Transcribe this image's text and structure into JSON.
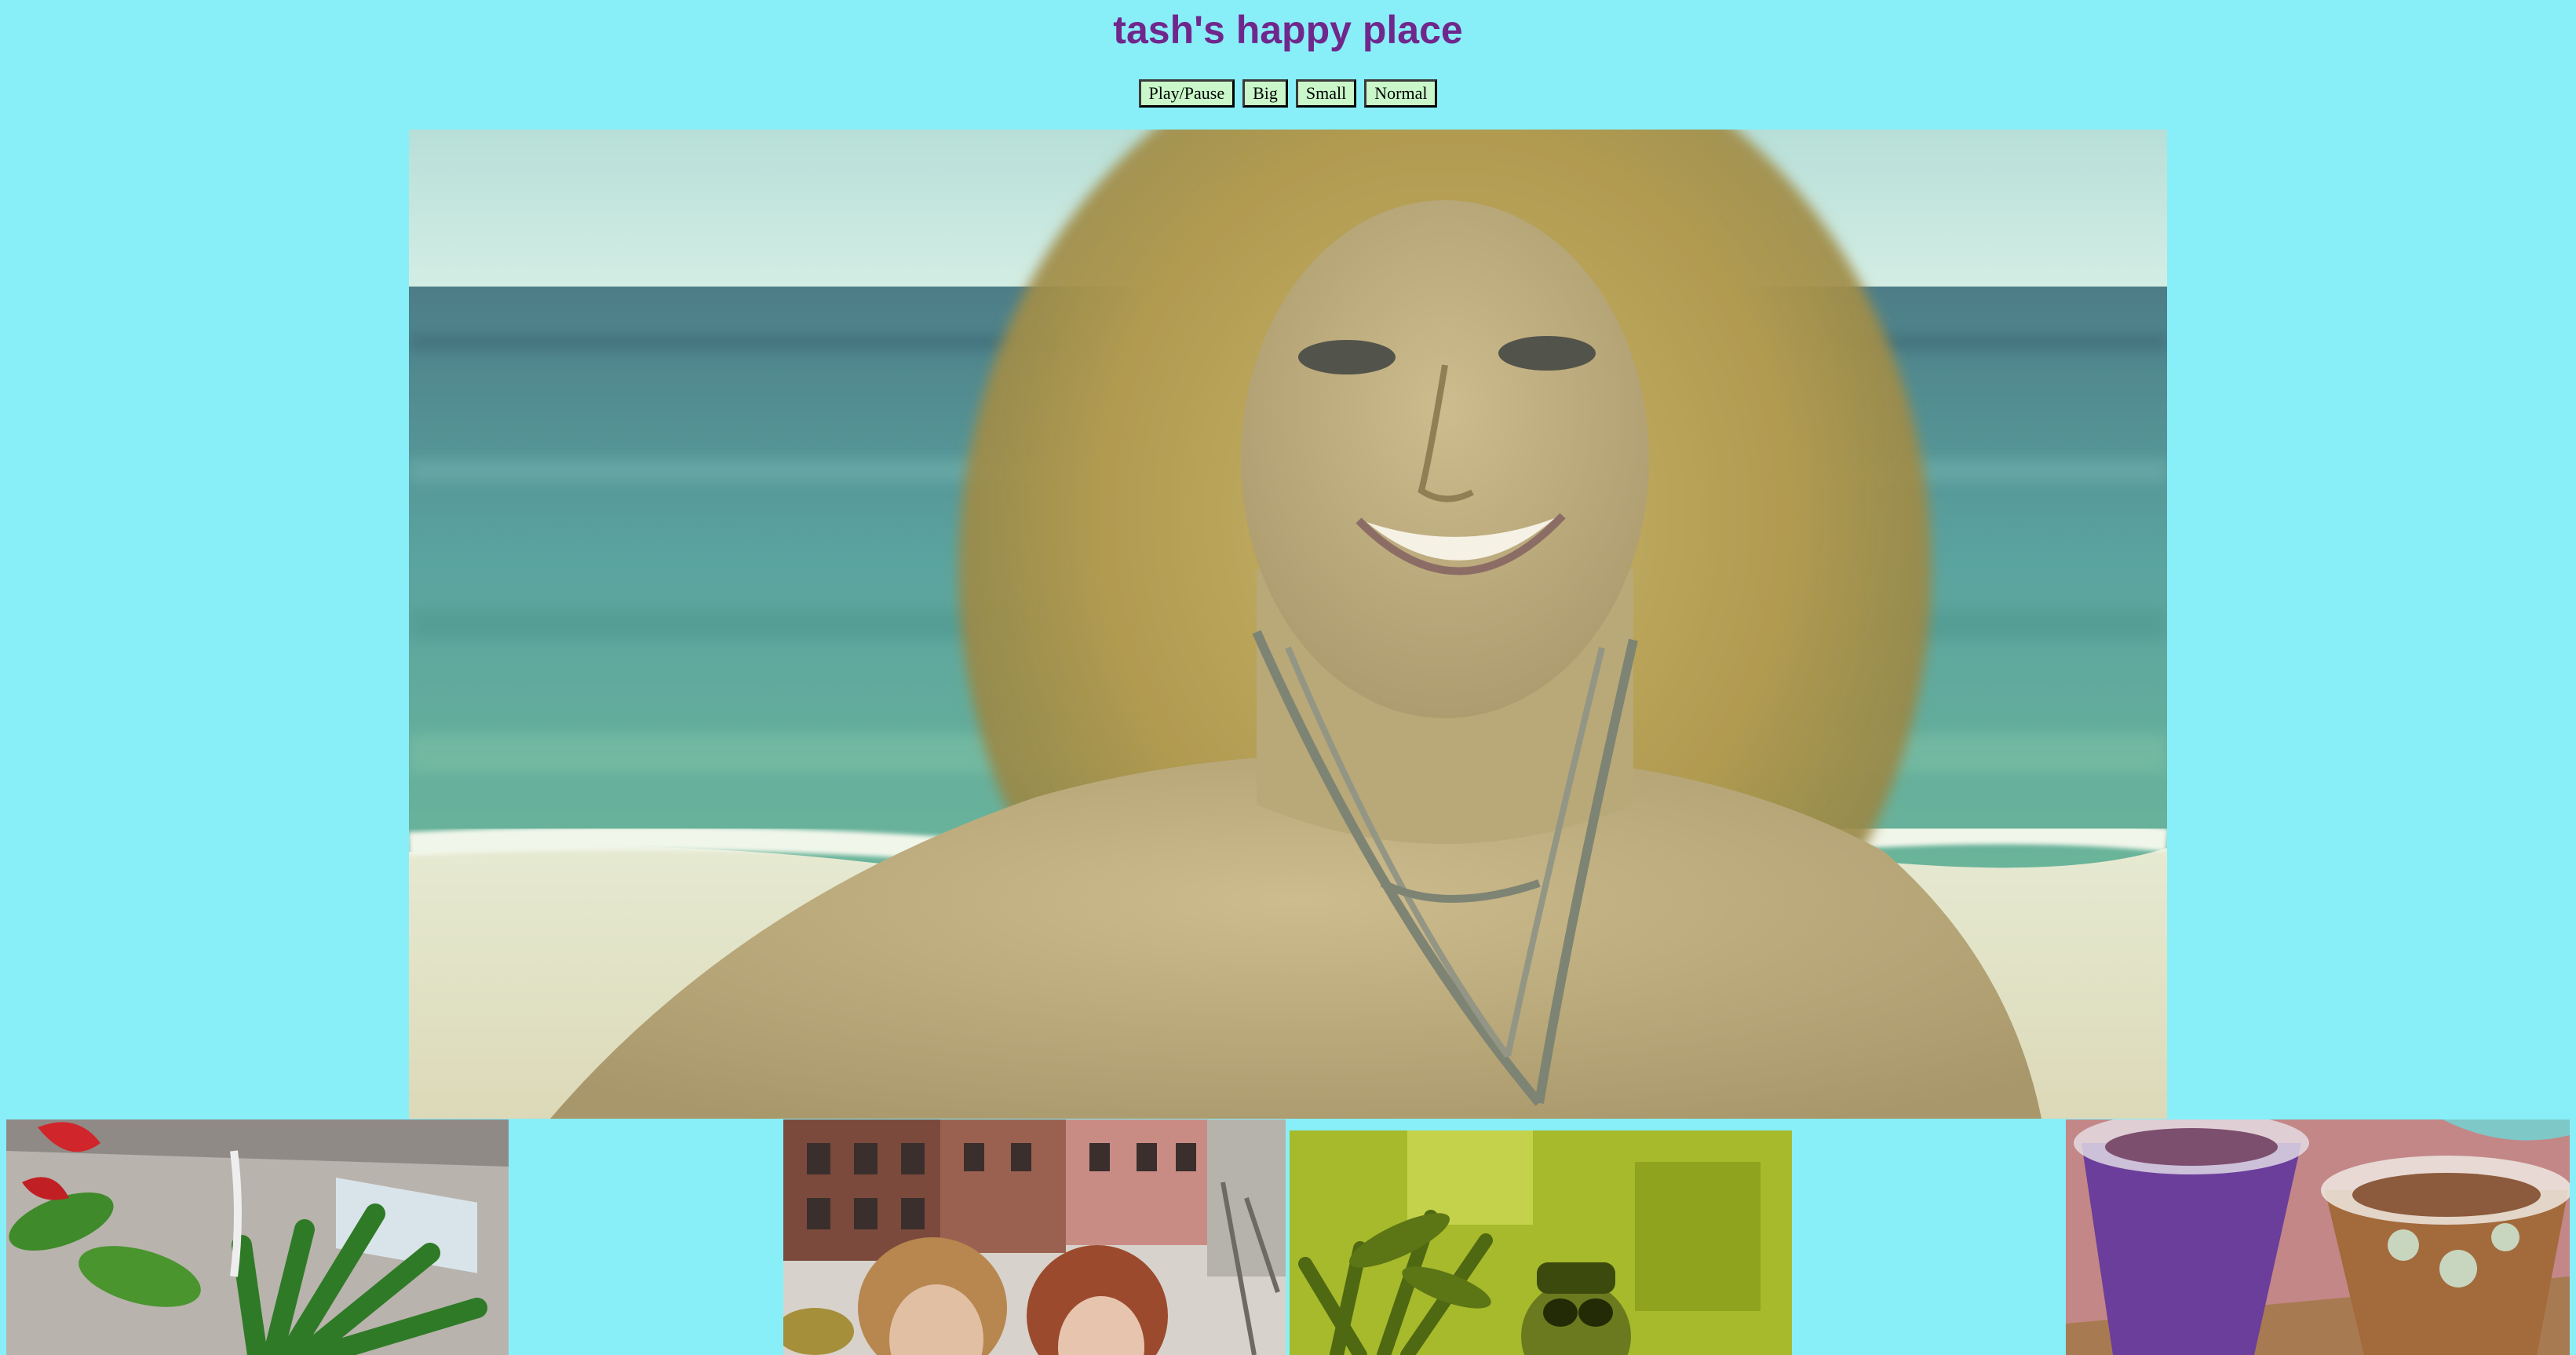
{
  "page": {
    "title": "tash's happy place",
    "background": "#88eff8",
    "title_color": "#70278c",
    "button_color": "#c9f7c9"
  },
  "controls": {
    "play_pause_label": "Play/Pause",
    "big_label": "Big",
    "small_label": "Small",
    "normal_label": "Normal"
  },
  "media": {
    "main_video": "video of a smiling woman with curly blonde hair on a beach",
    "thumbnails": [
      "tropical plants under a skylight",
      "two women posing in front of brownstone buildings",
      "person in sunglasses and a cap in a room with plants, green tint",
      "purple and brown iced drinks topped with dried flowers"
    ]
  }
}
